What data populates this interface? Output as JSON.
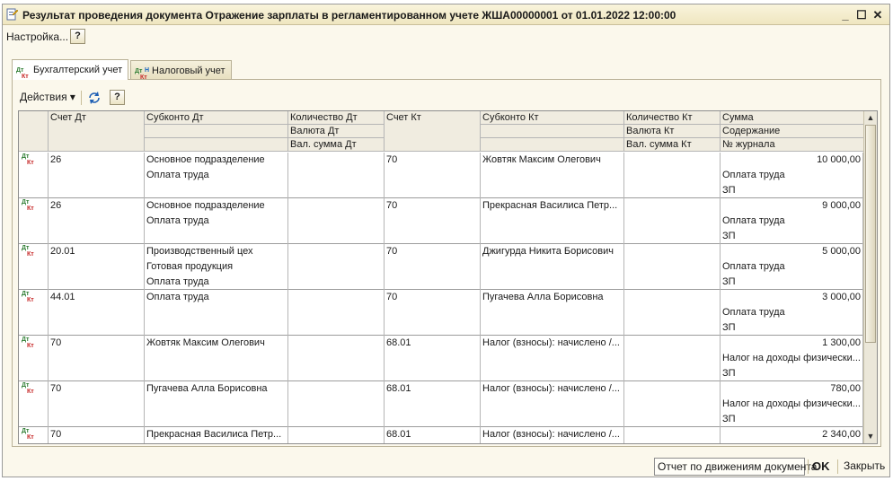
{
  "window": {
    "title": "Результат проведения документа Отражение зарплаты в регламентированном учете ЖША00000001 от 01.01.2022 12:00:00",
    "minimize": "_",
    "maximize": "☐",
    "close": "✕"
  },
  "menu": {
    "settings_label": "Настройка...",
    "help_label": "?"
  },
  "tabs": [
    {
      "label": "Бухгалтерский учет",
      "active": true
    },
    {
      "label": "Налоговый учет",
      "active": false
    }
  ],
  "toolbar": {
    "actions_label": "Действия ▾",
    "help_label": "?"
  },
  "table": {
    "headers": {
      "schet_dt": "Счет Дт",
      "subkonto_dt": "Субконто Дт",
      "kol_dt": "Количество Дт",
      "valuta_dt": "Валюта Дт",
      "val_summa_dt": "Вал. сумма Дт",
      "schet_kt": "Счет Кт",
      "subkonto_kt": "Субконто Кт",
      "kol_kt": "Количество Кт",
      "valuta_kt": "Валюта Кт",
      "val_summa_kt": "Вал. сумма Кт",
      "summa": "Сумма",
      "soderzhanie": "Содержание",
      "nomer_zhurnala": "№ журнала"
    },
    "row_icon": {
      "dt": "Дт",
      "kt": "Кт"
    },
    "rows": [
      {
        "schet_dt": "26",
        "subkonto_dt": [
          "Основное подразделение",
          "Оплата труда",
          ""
        ],
        "schet_kt": "70",
        "subkonto_kt": "Жовтяк Максим Олегович",
        "summa": "10 000,00",
        "soderzhanie": "Оплата труда",
        "zhurnal": "ЗП"
      },
      {
        "schet_dt": "26",
        "subkonto_dt": [
          "Основное подразделение",
          "Оплата труда",
          ""
        ],
        "schet_kt": "70",
        "subkonto_kt": "Прекрасная Василиса Петр...",
        "summa": "9 000,00",
        "soderzhanie": "Оплата труда",
        "zhurnal": "ЗП"
      },
      {
        "schet_dt": "20.01",
        "subkonto_dt": [
          "Производственный цех",
          "Готовая продукция",
          "Оплата труда"
        ],
        "schet_kt": "70",
        "subkonto_kt": "Джигурда Никита Борисович",
        "summa": "5 000,00",
        "soderzhanie": "Оплата труда",
        "zhurnal": "ЗП"
      },
      {
        "schet_dt": "44.01",
        "subkonto_dt": [
          "Оплата труда",
          "",
          ""
        ],
        "schet_kt": "70",
        "subkonto_kt": "Пугачева Алла Борисовна",
        "summa": "3 000,00",
        "soderzhanie": "Оплата труда",
        "zhurnal": "ЗП"
      },
      {
        "schet_dt": "70",
        "subkonto_dt": [
          "Жовтяк Максим Олегович",
          "",
          ""
        ],
        "schet_kt": "68.01",
        "subkonto_kt": "Налог (взносы): начислено /...",
        "summa": "1 300,00",
        "soderzhanie": "Налог на доходы физически...",
        "zhurnal": "ЗП"
      },
      {
        "schet_dt": "70",
        "subkonto_dt": [
          "Пугачева Алла Борисовна",
          "",
          ""
        ],
        "schet_kt": "68.01",
        "subkonto_kt": "Налог (взносы): начислено /...",
        "summa": "780,00",
        "soderzhanie": "Налог на доходы физически...",
        "zhurnal": "ЗП"
      },
      {
        "schet_dt": "70",
        "subkonto_dt": [
          "Прекрасная Василиса Петр...",
          "",
          ""
        ],
        "schet_kt": "68.01",
        "subkonto_kt": "Налог (взносы): начислено /...",
        "summa": "2 340,00",
        "soderzhanie": "",
        "zhurnal": ""
      }
    ]
  },
  "footer": {
    "report_label": "Отчет по движениям документа",
    "ok_label": "OK",
    "close_label": "Закрыть"
  }
}
